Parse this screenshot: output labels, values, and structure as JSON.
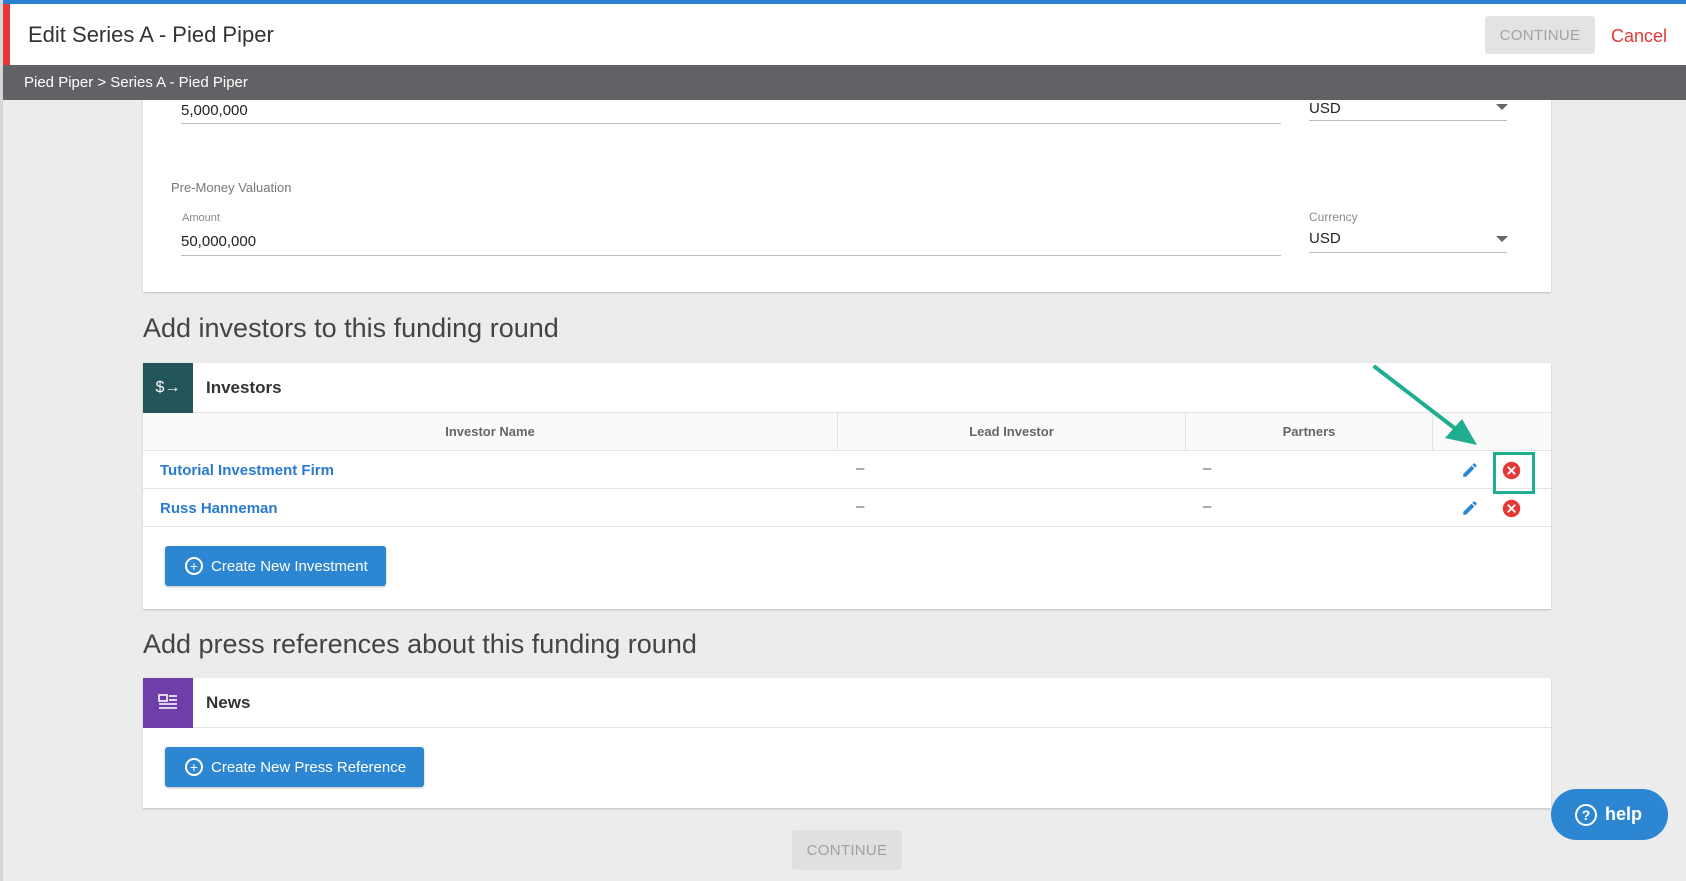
{
  "header": {
    "title": "Edit Series A - Pied Piper",
    "continue_label": "CONTINUE",
    "cancel_label": "Cancel"
  },
  "breadcrumb": "Pied Piper > Series A - Pied Piper",
  "money_raised": {
    "amount": "5,000,000",
    "currency": "USD"
  },
  "pre_money": {
    "group_label": "Pre-Money Valuation",
    "amount_label": "Amount",
    "amount": "50,000,000",
    "currency_label": "Currency",
    "currency": "USD"
  },
  "investors_section": {
    "heading": "Add investors to this funding round",
    "card_title": "Investors",
    "icon": "$→",
    "columns": [
      "Investor Name",
      "Lead Investor",
      "Partners"
    ],
    "rows": [
      {
        "name": "Tutorial Investment Firm",
        "lead": "–",
        "partners": "–"
      },
      {
        "name": "Russ Hanneman",
        "lead": "–",
        "partners": "–"
      }
    ],
    "create_button": "Create New Investment"
  },
  "news_section": {
    "heading": "Add press references about this funding round",
    "card_title": "News",
    "icon": "newspaper-icon",
    "create_button": "Create New Press Reference"
  },
  "footer": {
    "continue_label": "CONTINUE"
  },
  "help": {
    "label": "help"
  },
  "colors": {
    "accent_blue": "#2d86d2",
    "danger_red": "#e53935",
    "investors_icon_bg": "#24555a",
    "news_icon_bg": "#6e3fa8",
    "annotation_teal": "#1fae8f"
  }
}
